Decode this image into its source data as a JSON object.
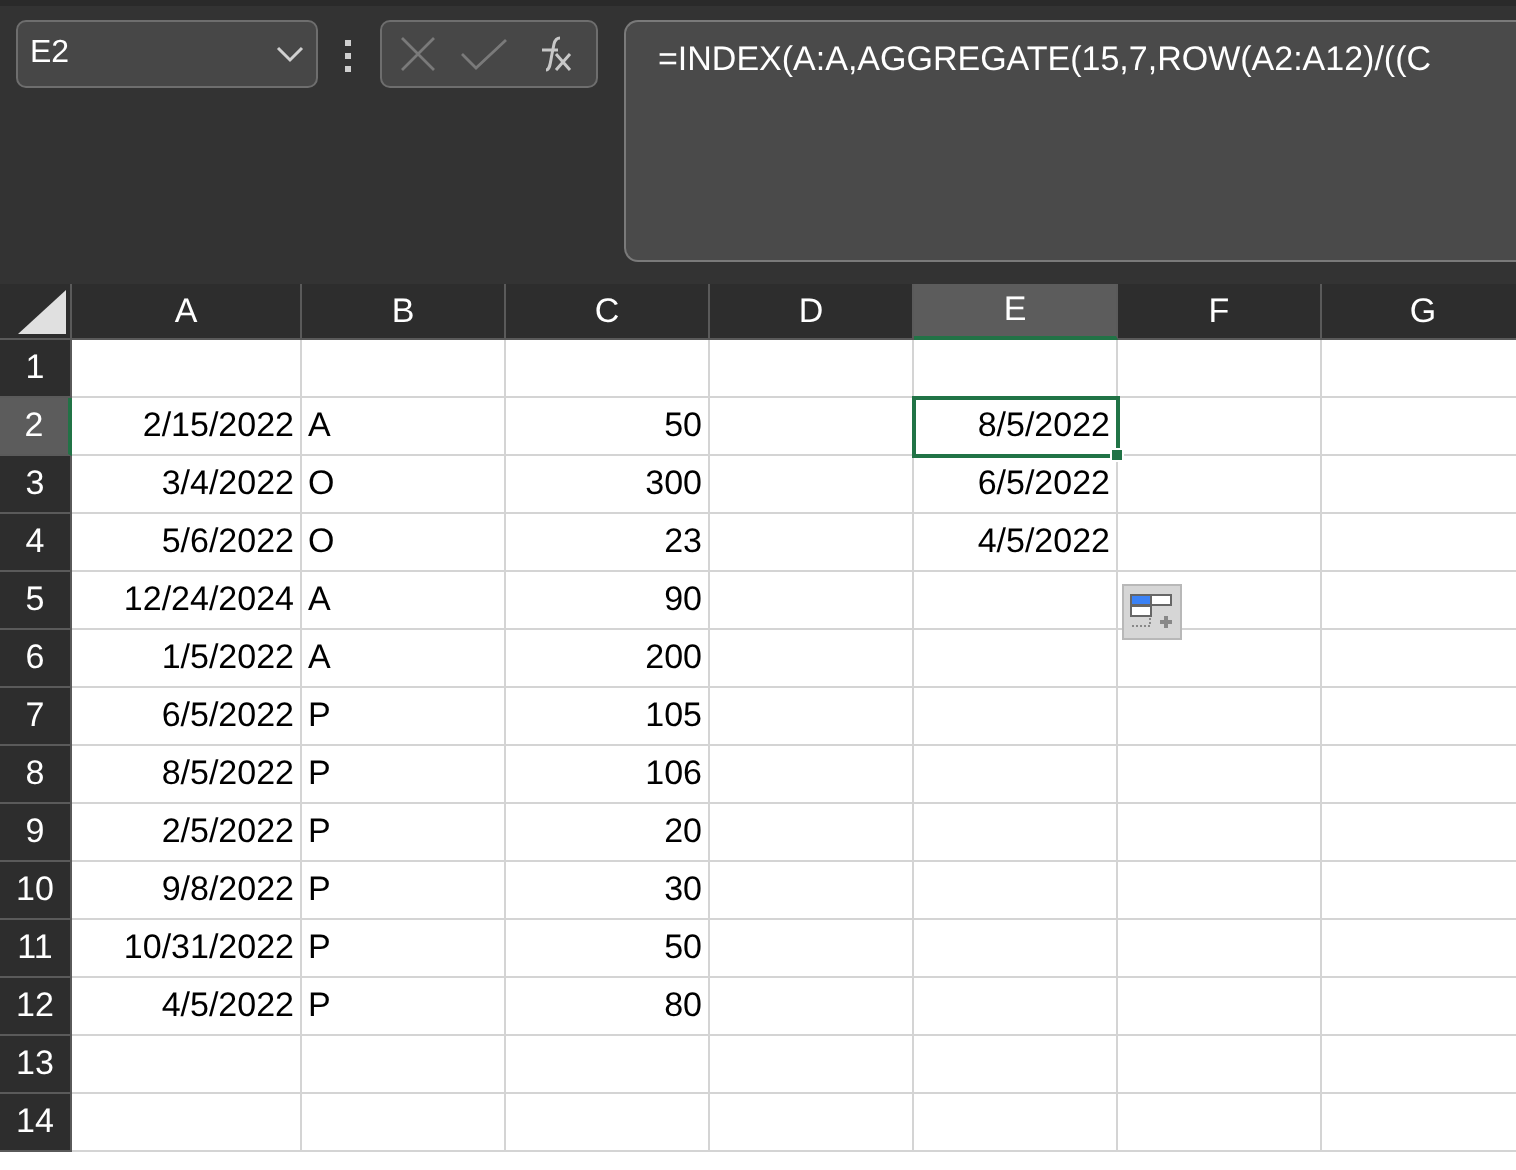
{
  "name_box": {
    "value": "E2"
  },
  "formula_bar": {
    "formula": "=INDEX(A:A,AGGREGATE(15,7,ROW(A2:A12)/((C"
  },
  "columns": [
    {
      "label": "A",
      "selected": false
    },
    {
      "label": "B",
      "selected": false
    },
    {
      "label": "C",
      "selected": false
    },
    {
      "label": "D",
      "selected": false
    },
    {
      "label": "E",
      "selected": true
    },
    {
      "label": "F",
      "selected": false
    },
    {
      "label": "G",
      "selected": false
    }
  ],
  "rows": [
    {
      "label": "1",
      "selected": false,
      "cells": {}
    },
    {
      "label": "2",
      "selected": true,
      "cells": {
        "column_1": {
          "text": "2/15/2022",
          "kind": "number",
          "selected": false
        },
        "column_2": {
          "text": "A",
          "kind": "text",
          "selected": false
        },
        "column_3": {
          "text": "50",
          "kind": "number",
          "selected": false
        },
        "column_5": {
          "text": "8/5/2022",
          "kind": "number",
          "selected": true
        }
      }
    },
    {
      "label": "3",
      "selected": false,
      "cells": {
        "column_1": {
          "text": "3/4/2022",
          "kind": "number",
          "selected": false
        },
        "column_2": {
          "text": "O",
          "kind": "text",
          "selected": false
        },
        "column_3": {
          "text": "300",
          "kind": "number",
          "selected": false
        },
        "column_5": {
          "text": "6/5/2022",
          "kind": "number",
          "selected": false
        }
      }
    },
    {
      "label": "4",
      "selected": false,
      "cells": {
        "column_1": {
          "text": "5/6/2022",
          "kind": "number",
          "selected": false
        },
        "column_2": {
          "text": "O",
          "kind": "text",
          "selected": false
        },
        "column_3": {
          "text": "23",
          "kind": "number",
          "selected": false
        },
        "column_5": {
          "text": "4/5/2022",
          "kind": "number",
          "selected": false
        }
      }
    },
    {
      "label": "5",
      "selected": false,
      "cells": {
        "column_1": {
          "text": "12/24/2024",
          "kind": "number",
          "selected": false
        },
        "column_2": {
          "text": "A",
          "kind": "text",
          "selected": false
        },
        "column_3": {
          "text": "90",
          "kind": "number",
          "selected": false
        }
      }
    },
    {
      "label": "6",
      "selected": false,
      "cells": {
        "column_1": {
          "text": "1/5/2022",
          "kind": "number",
          "selected": false
        },
        "column_2": {
          "text": "A",
          "kind": "text",
          "selected": false
        },
        "column_3": {
          "text": "200",
          "kind": "number",
          "selected": false
        }
      }
    },
    {
      "label": "7",
      "selected": false,
      "cells": {
        "column_1": {
          "text": "6/5/2022",
          "kind": "number",
          "selected": false
        },
        "column_2": {
          "text": "P",
          "kind": "text",
          "selected": false
        },
        "column_3": {
          "text": "105",
          "kind": "number",
          "selected": false
        }
      }
    },
    {
      "label": "8",
      "selected": false,
      "cells": {
        "column_1": {
          "text": "8/5/2022",
          "kind": "number",
          "selected": false
        },
        "column_2": {
          "text": "P",
          "kind": "text",
          "selected": false
        },
        "column_3": {
          "text": "106",
          "kind": "number",
          "selected": false
        }
      }
    },
    {
      "label": "9",
      "selected": false,
      "cells": {
        "column_1": {
          "text": "2/5/2022",
          "kind": "number",
          "selected": false
        },
        "column_2": {
          "text": "P",
          "kind": "text",
          "selected": false
        },
        "column_3": {
          "text": "20",
          "kind": "number",
          "selected": false
        }
      }
    },
    {
      "label": "10",
      "selected": false,
      "cells": {
        "column_1": {
          "text": "9/8/2022",
          "kind": "number",
          "selected": false
        },
        "column_2": {
          "text": "P",
          "kind": "text",
          "selected": false
        },
        "column_3": {
          "text": "30",
          "kind": "number",
          "selected": false
        }
      }
    },
    {
      "label": "11",
      "selected": false,
      "cells": {
        "column_1": {
          "text": "10/31/2022",
          "kind": "number",
          "selected": false
        },
        "column_2": {
          "text": "P",
          "kind": "text",
          "selected": false
        },
        "column_3": {
          "text": "50",
          "kind": "number",
          "selected": false
        }
      }
    },
    {
      "label": "12",
      "selected": false,
      "cells": {
        "column_1": {
          "text": "4/5/2022",
          "kind": "number",
          "selected": false
        },
        "column_2": {
          "text": "P",
          "kind": "text",
          "selected": false
        },
        "column_3": {
          "text": "80",
          "kind": "number",
          "selected": false
        }
      }
    },
    {
      "label": "13",
      "selected": false,
      "cells": {}
    },
    {
      "label": "14",
      "selected": false,
      "cells": {}
    }
  ]
}
